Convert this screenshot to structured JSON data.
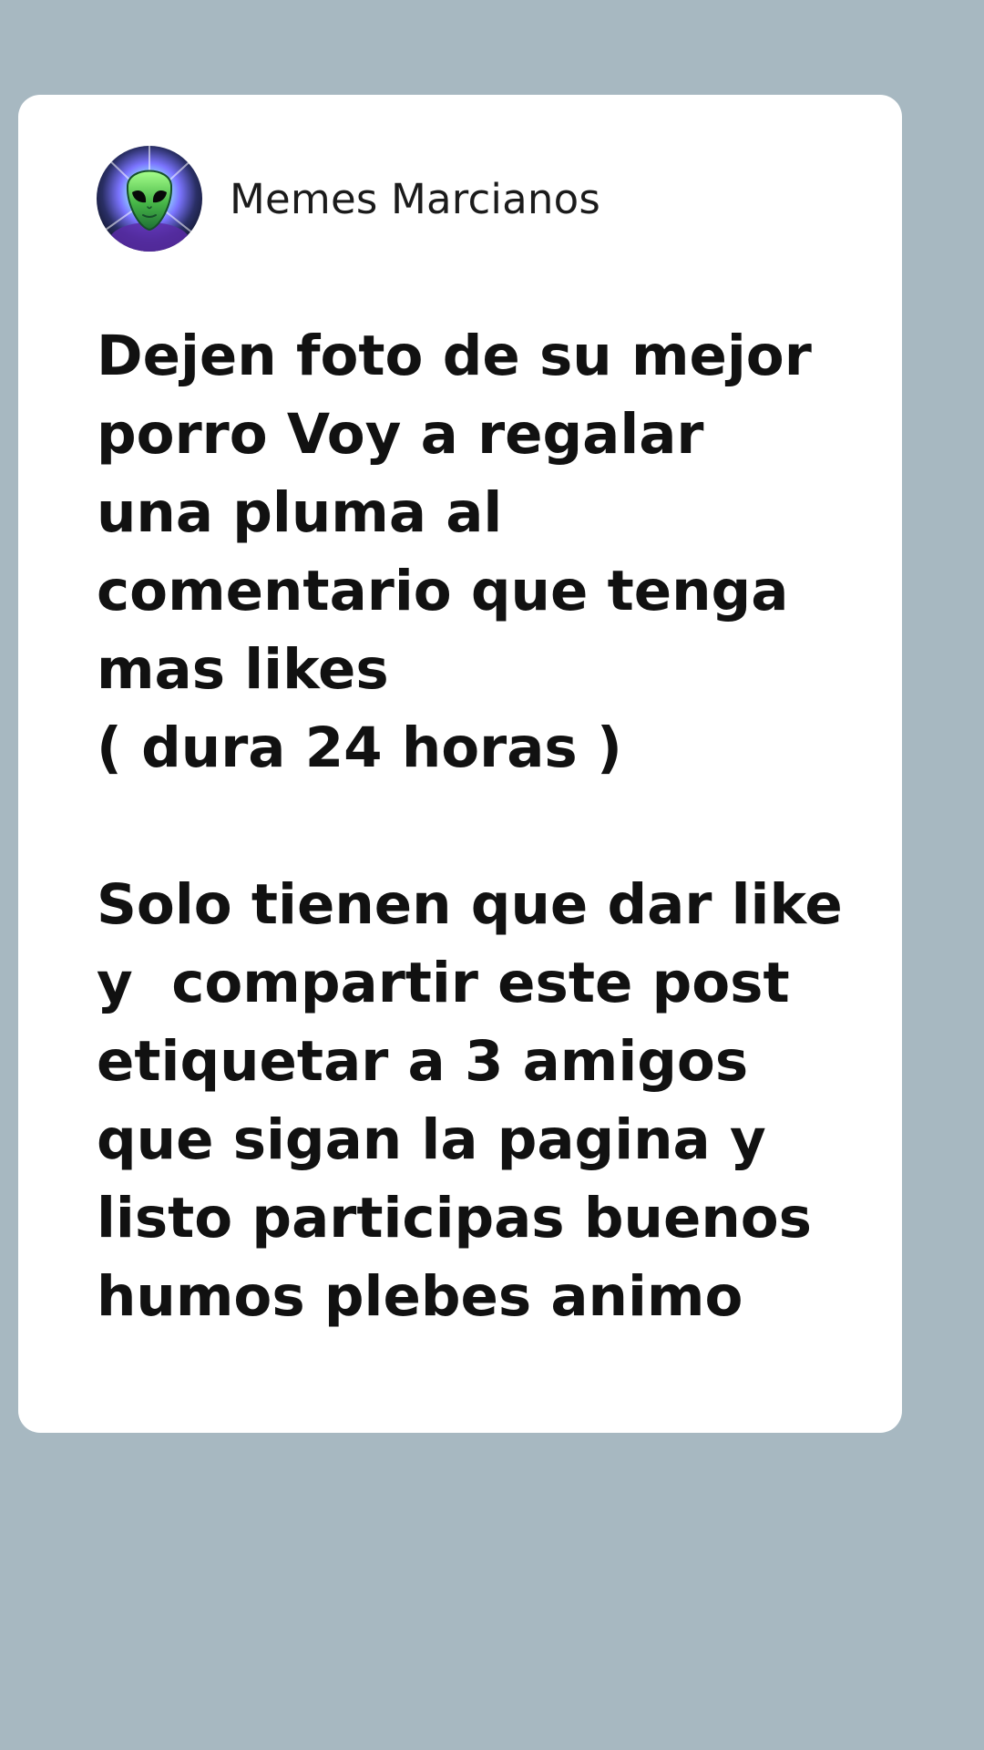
{
  "post": {
    "author": {
      "name": "Memes Marcianos",
      "avatar_icon": "alien-face-icon"
    },
    "text": "Dejen foto de su mejor\nporro Voy a regalar\nuna pluma al\ncomentario que tenga\nmas likes\n( dura 24 horas )\n\nSolo tienen que dar like\ny  compartir este post\netiquetar a 3 amigos\nque sigan la pagina y\nlisto participas buenos\nhumos plebes animo"
  },
  "colors": {
    "background": "#a7b8c1",
    "card": "#ffffff",
    "text": "#111111"
  }
}
